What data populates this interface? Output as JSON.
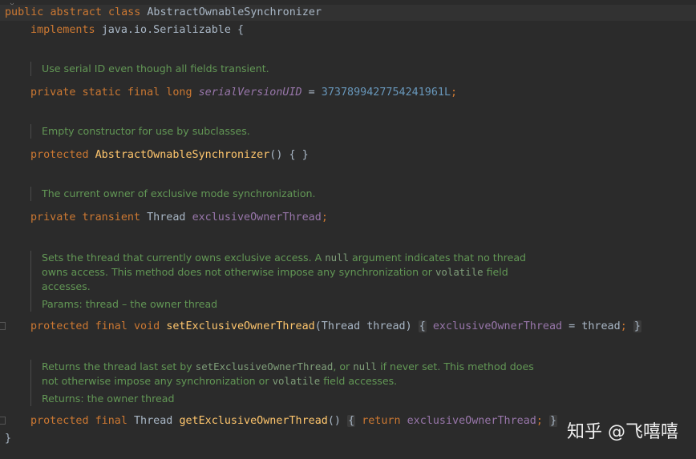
{
  "code": {
    "l1_public": "public",
    "l1_abstract": "abstract",
    "l1_class": "class",
    "l1_name": "AbstractOwnableSynchronizer",
    "l2_implements": "implements",
    "l2_type": "java.io.Serializable {",
    "doc1": "Use serial ID even though all fields transient.",
    "l3_mods": "private static final long",
    "l3_field": "serialVersionUID",
    "l3_eq": " = ",
    "l3_num": "3737899427754241961L",
    "l3_semi": ";",
    "doc2": "Empty constructor for use by subclasses.",
    "l4_mod": "protected",
    "l4_ctor": "AbstractOwnableSynchronizer",
    "l4_rest": "() { }",
    "doc3": "The current owner of exclusive mode synchronization.",
    "l5_mods": "private transient",
    "l5_type": "Thread",
    "l5_field": "exclusiveOwnerThread",
    "l5_semi": ";",
    "doc4_a": "Sets the thread that currently owns exclusive access. A ",
    "doc4_null": "null",
    "doc4_b": " argument indicates that no thread",
    "doc4_c": "owns access. This method does not otherwise impose any synchronization or ",
    "doc4_volatile": "volatile",
    "doc4_d": " field",
    "doc4_e": "accesses.",
    "doc4_params": "Params: thread – the owner thread",
    "l6_mods": "protected final void",
    "l6_method": "setExclusiveOwnerThread",
    "l6_params": "(Thread thread)",
    "l6_open": "{",
    "l6_field": "exclusiveOwnerThread",
    "l6_assign": " = thread",
    "l6_semi": ";",
    "l6_close": "}",
    "doc5_a": "Returns the thread last set by ",
    "doc5_code": "setExclusiveOwnerThread",
    "doc5_b": ", or ",
    "doc5_null": "null",
    "doc5_c": " if never set. This method does",
    "doc5_d": "not otherwise impose any synchronization or ",
    "doc5_volatile": "volatile",
    "doc5_e": " field accesses.",
    "doc5_returns": "Returns: the owner thread",
    "l7_mods": "protected final",
    "l7_type": "Thread",
    "l7_method": "getExclusiveOwnerThread",
    "l7_paren": "()",
    "l7_open": "{",
    "l7_return": "return",
    "l7_field": "exclusiveOwnerThread",
    "l7_semi": ";",
    "l7_close": "}",
    "l8_close": "}"
  },
  "watermark": "知乎 @飞嘻嘻",
  "colors": {
    "background": "#2b2b2b",
    "keyword": "#cc7832",
    "field": "#9876aa",
    "number": "#6897bb",
    "method": "#ffc66d",
    "doc": "#629755",
    "text": "#a9b7c6"
  }
}
